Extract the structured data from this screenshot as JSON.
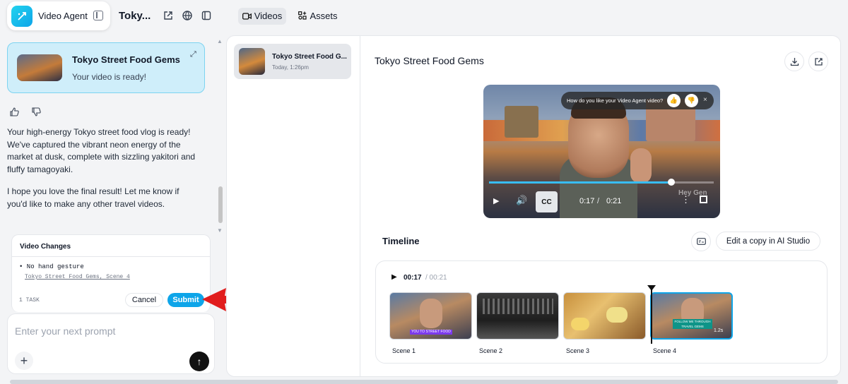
{
  "app": {
    "name": "Video Agent",
    "project_title": "Toky..."
  },
  "tabs": {
    "videos": "Videos",
    "assets": "Assets"
  },
  "chat": {
    "ready_card": {
      "title": "Tokyo Street Food Gems",
      "subtitle": "Your video is ready!"
    },
    "message_1": "Your high-energy Tokyo street food vlog is ready! We've captured the vibrant neon energy of the market at dusk, complete with sizzling yakitori and fluffy tamagoyaki.",
    "message_2": "I hope you love the final result! Let me know if you'd like to make any other travel videos."
  },
  "changes": {
    "title": "Video Changes",
    "items": [
      {
        "text": "• No hand gesture",
        "ref": "Tokyo Street Food Gems, Scene 4"
      }
    ],
    "task_count": "1 TASK",
    "cancel": "Cancel",
    "submit": "Submit"
  },
  "prompt": {
    "placeholder": "Enter your next prompt"
  },
  "video_list": [
    {
      "title": "Tokyo Street Food G...",
      "date": "Today, 1:26pm"
    }
  ],
  "main": {
    "title": "Tokyo Street Food Gems",
    "feedback_question": "How do you like your Video Agent video?",
    "player": {
      "current": "0:17",
      "separator": "/",
      "duration": "0:21",
      "progress": 0.81,
      "cc": "CC",
      "watermark": "Hey Gen"
    },
    "timeline_label": "Timeline",
    "edit_copy": "Edit a copy in AI Studio",
    "timeline": {
      "current": "00:17",
      "duration": "/ 00:21"
    },
    "scenes": [
      {
        "label": "Scene 1",
        "caption": "YOU TO STREET FOOD"
      },
      {
        "label": "Scene 2",
        "caption": ""
      },
      {
        "label": "Scene 3",
        "caption": ""
      },
      {
        "label": "Scene 4",
        "caption": "FOLLOW ME THROUGH TRAVEL GEMS",
        "tag": "1.2s"
      }
    ]
  },
  "colors": {
    "accent": "#0ea5e9",
    "arrow": "#e11d1d"
  }
}
